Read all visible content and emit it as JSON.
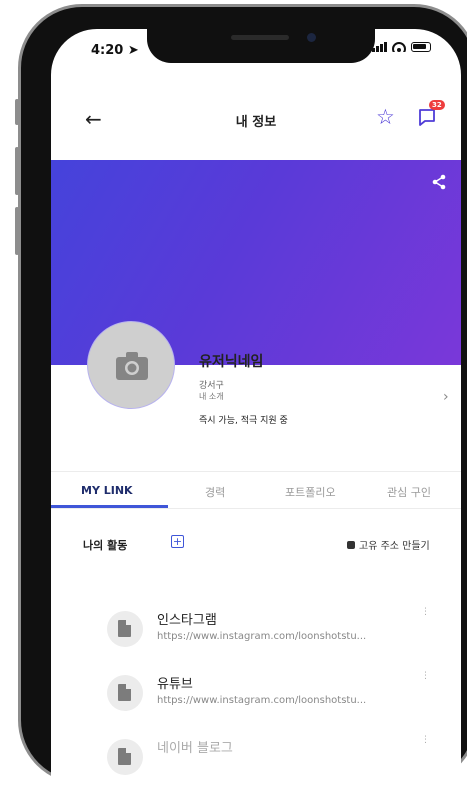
{
  "status": {
    "time": "4:20"
  },
  "header": {
    "back_icon": "arrow-left-icon",
    "title": "내 정보",
    "notification_count": "32"
  },
  "profile": {
    "nickname": "유저닉네임",
    "location": "강서구",
    "intro": "내 소개",
    "availability": "즉시 가능, 적극 지원 중"
  },
  "tabs": [
    "MY LINK",
    "경력",
    "포트폴리오",
    "관심 구인"
  ],
  "activity": {
    "label": "나의 활동",
    "address_button": "고유 주소 만들기"
  },
  "links": [
    {
      "title": "인스타그램",
      "url": "https://www.instagram.com/loonshotstu..."
    },
    {
      "title": "유튜브",
      "url": "https://www.instagram.com/loonshotstu..."
    },
    {
      "title": "네이버 블로그",
      "url": ""
    }
  ],
  "colors": {
    "accent": "#3f56d8",
    "banner_start": "#4543db",
    "banner_end": "#7a38d9",
    "badge": "#ee3d3d"
  }
}
